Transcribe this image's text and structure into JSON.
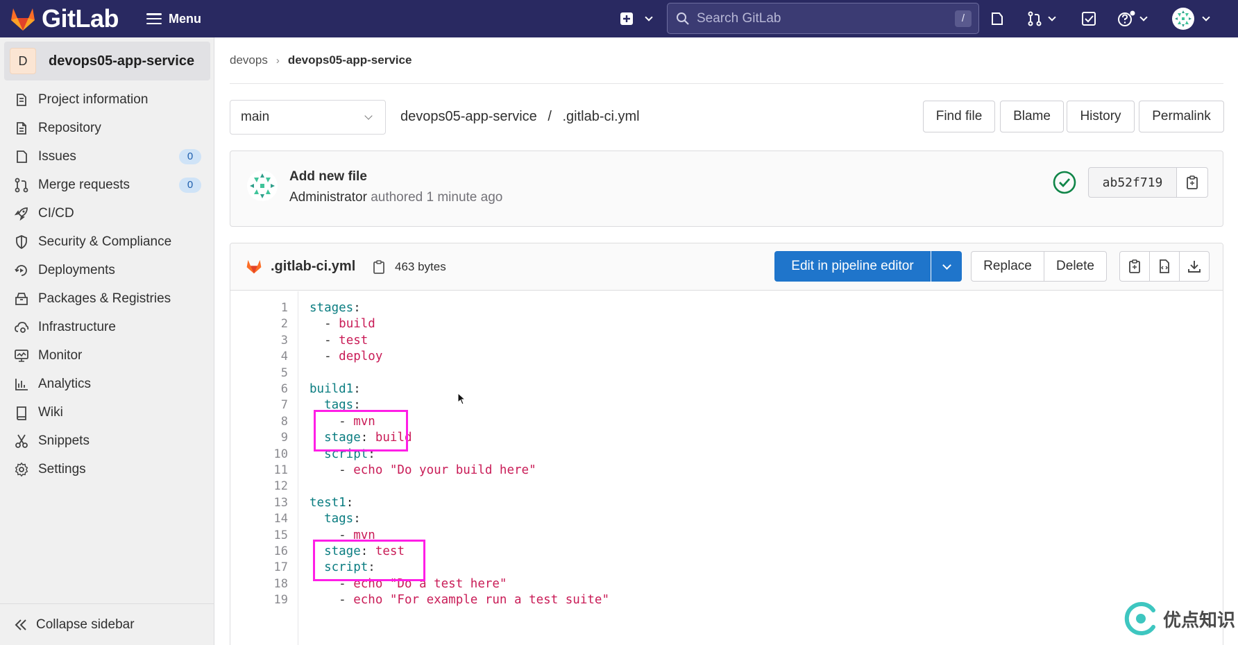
{
  "topbar": {
    "brand": "GitLab",
    "menu_label": "Menu",
    "search_placeholder": "Search GitLab",
    "search_shortcut": "/",
    "colors": {
      "background": "#292961",
      "logo_orange": "#fc6d26"
    }
  },
  "sidebar": {
    "project_initial": "D",
    "project_name": "devops05-app-service",
    "items": [
      {
        "label": "Project information",
        "icon": "project-icon"
      },
      {
        "label": "Repository",
        "icon": "doc-icon"
      },
      {
        "label": "Issues",
        "icon": "issues-icon",
        "badge": "0"
      },
      {
        "label": "Merge requests",
        "icon": "merge-request-icon",
        "badge": "0"
      },
      {
        "label": "CI/CD",
        "icon": "rocket-icon"
      },
      {
        "label": "Security & Compliance",
        "icon": "shield-icon"
      },
      {
        "label": "Deployments",
        "icon": "deployments-icon"
      },
      {
        "label": "Packages & Registries",
        "icon": "package-icon"
      },
      {
        "label": "Infrastructure",
        "icon": "cloud-gear-icon"
      },
      {
        "label": "Monitor",
        "icon": "monitor-icon"
      },
      {
        "label": "Analytics",
        "icon": "chart-icon"
      },
      {
        "label": "Wiki",
        "icon": "book-icon"
      },
      {
        "label": "Snippets",
        "icon": "scissors-icon"
      },
      {
        "label": "Settings",
        "icon": "gear-icon"
      }
    ],
    "collapse_label": "Collapse sidebar"
  },
  "breadcrumb": {
    "parent": "devops",
    "separator": "›",
    "current": "devops05-app-service"
  },
  "file_nav": {
    "branch": "main",
    "path_project": "devops05-app-service",
    "path_sep": "/",
    "path_file": ".gitlab-ci.yml",
    "buttons": {
      "find_file": "Find file",
      "blame": "Blame",
      "history": "History",
      "permalink": "Permalink"
    }
  },
  "commit": {
    "title": "Add new file",
    "author": "Administrator",
    "meta": "authored 1 minute ago",
    "sha": "ab52f719",
    "status": "passed"
  },
  "file": {
    "name": ".gitlab-ci.yml",
    "size": "463 bytes",
    "edit_label": "Edit in pipeline editor",
    "replace_label": "Replace",
    "delete_label": "Delete",
    "colors": {
      "primary": "#1f75cb",
      "key": "#0b7d81",
      "string": "#c91c57",
      "highlight_box": "#ff1ee6"
    },
    "line_numbers": [
      "1",
      "2",
      "3",
      "4",
      "5",
      "6",
      "7",
      "8",
      "9",
      "10",
      "11",
      "12",
      "13",
      "14",
      "15",
      "16",
      "17",
      "18",
      "19"
    ],
    "lines": [
      {
        "k": "stages",
        "p": ":"
      },
      {
        "p": "  - ",
        "s": "build"
      },
      {
        "p": "  - ",
        "s": "test"
      },
      {
        "p": "  - ",
        "s": "deploy"
      },
      {
        "p": ""
      },
      {
        "k": "build1",
        "p": ":"
      },
      {
        "ind": "  ",
        "k": "tags",
        "p": ":"
      },
      {
        "p": "    - ",
        "s": "mvn"
      },
      {
        "ind": "  ",
        "k": "stage",
        "p": ": ",
        "s": "build"
      },
      {
        "ind": "  ",
        "k": "script",
        "p": ":"
      },
      {
        "p": "    - ",
        "s": "echo \"Do your build here\""
      },
      {
        "p": ""
      },
      {
        "k": "test1",
        "p": ":"
      },
      {
        "ind": "  ",
        "k": "tags",
        "p": ":"
      },
      {
        "p": "    - ",
        "s": "mvn"
      },
      {
        "ind": "  ",
        "k": "stage",
        "p": ": ",
        "s": "test"
      },
      {
        "ind": "  ",
        "k": "script",
        "p": ":"
      },
      {
        "p": "    - ",
        "s": "echo \"Do a test here\""
      },
      {
        "p": "    - ",
        "s": "echo \"For example run a test suite\""
      }
    ]
  },
  "watermark": {
    "text": "优点知识"
  }
}
